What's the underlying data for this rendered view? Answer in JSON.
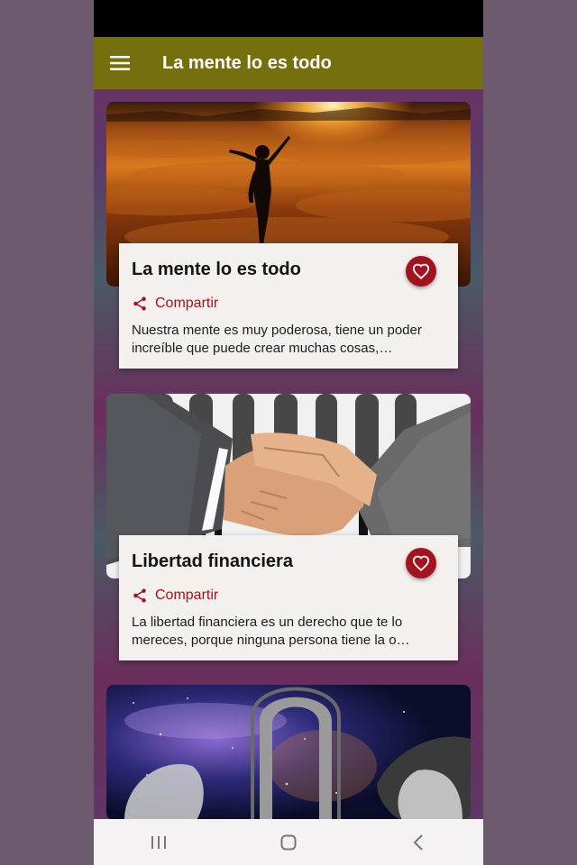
{
  "app": {
    "title": "La mente lo es todo",
    "menu_icon": "hamburger-menu-icon",
    "accent_color": "#75700d",
    "favorite_color": "#a3131f"
  },
  "cards": [
    {
      "title": "La mente lo es todo",
      "share_label": "Compartir",
      "text": "Nuestra mente es muy poderosa, tiene un poder increíble que puede crear muchas cosas,…",
      "image": "silhouette-sunset-clouds"
    },
    {
      "title": "Libertad financiera",
      "share_label": "Compartir",
      "text": "La libertad financiera es un derecho que te lo mereces, porque ninguna persona tiene la o…",
      "image": "handshake"
    },
    {
      "image": "cosmic-portal-faces"
    }
  ],
  "navigation": {
    "recents": "recents-icon",
    "home": "home-icon",
    "back": "back-icon"
  }
}
